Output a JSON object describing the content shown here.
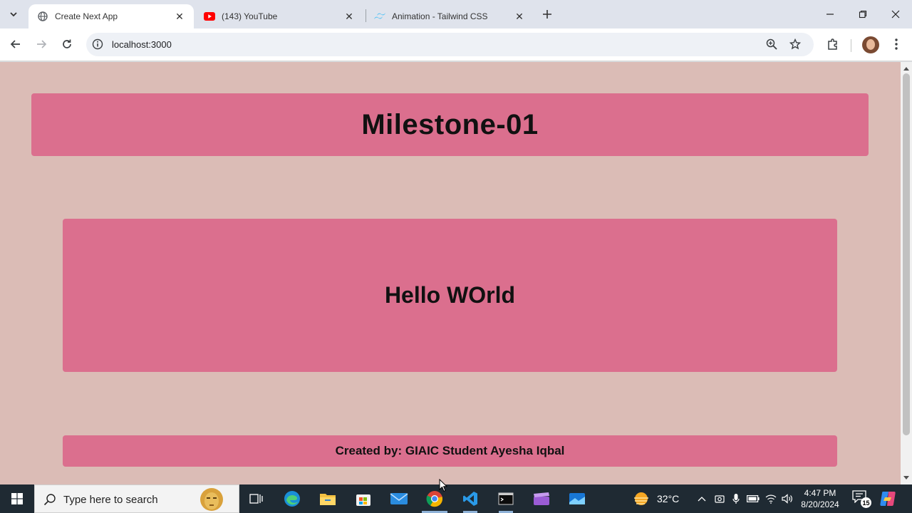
{
  "browser": {
    "tabs": [
      {
        "title": "Create Next App",
        "active": true,
        "icon": "globe-icon"
      },
      {
        "title": "(143) YouTube",
        "active": false,
        "icon": "youtube-icon"
      },
      {
        "title": "Animation - Tailwind CSS",
        "active": false,
        "icon": "tailwind-icon"
      }
    ],
    "url": "localhost:3000"
  },
  "page": {
    "header_title": "Milestone-01",
    "main_text": "Hello WOrld",
    "footer_text": "Created by: GIAIC Student Ayesha Iqbal"
  },
  "taskbar": {
    "search_placeholder": "Type here to search",
    "weather_temp": "32°C",
    "time": "4:47 PM",
    "date": "8/20/2024",
    "notification_count": "15"
  },
  "colors": {
    "page_background": "#dbbcb6",
    "box_pink": "#db6f8e",
    "taskbar": "#1f2a33"
  }
}
